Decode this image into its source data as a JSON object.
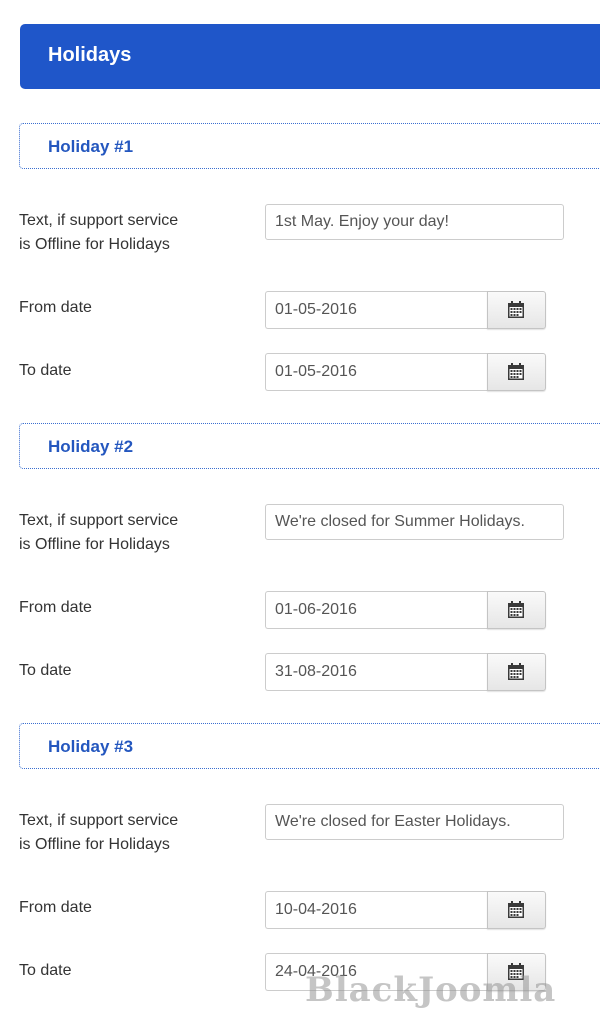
{
  "header": {
    "title": "Holidays"
  },
  "holidays": [
    {
      "legend": "Holiday #1",
      "text_label_line1": "Text, if support service",
      "text_label_line2": "is Offline for Holidays",
      "text_value": "1st May. Enjoy your day!",
      "from_label": "From date",
      "from_value": "01-05-2016",
      "to_label": "To date",
      "to_value": "01-05-2016"
    },
    {
      "legend": "Holiday #2",
      "text_label_line1": "Text, if support service",
      "text_label_line2": "is Offline for Holidays",
      "text_value": "We're closed for Summer Holidays.",
      "from_label": "From date",
      "from_value": "01-06-2016",
      "to_label": "To date",
      "to_value": "31-08-2016"
    },
    {
      "legend": "Holiday #3",
      "text_label_line1": "Text, if support service",
      "text_label_line2": "is Offline for Holidays",
      "text_value": "We're closed for Easter Holidays.",
      "from_label": "From date",
      "from_value": "10-04-2016",
      "to_label": "To date",
      "to_value": "24-04-2016"
    }
  ],
  "icons": {
    "calendar_button": "calendar-icon"
  },
  "colors": {
    "header_bg": "#1f56c9",
    "legend_text": "#2457bf",
    "legend_border": "#3b6fd0"
  },
  "watermark": "BlackJoomla"
}
